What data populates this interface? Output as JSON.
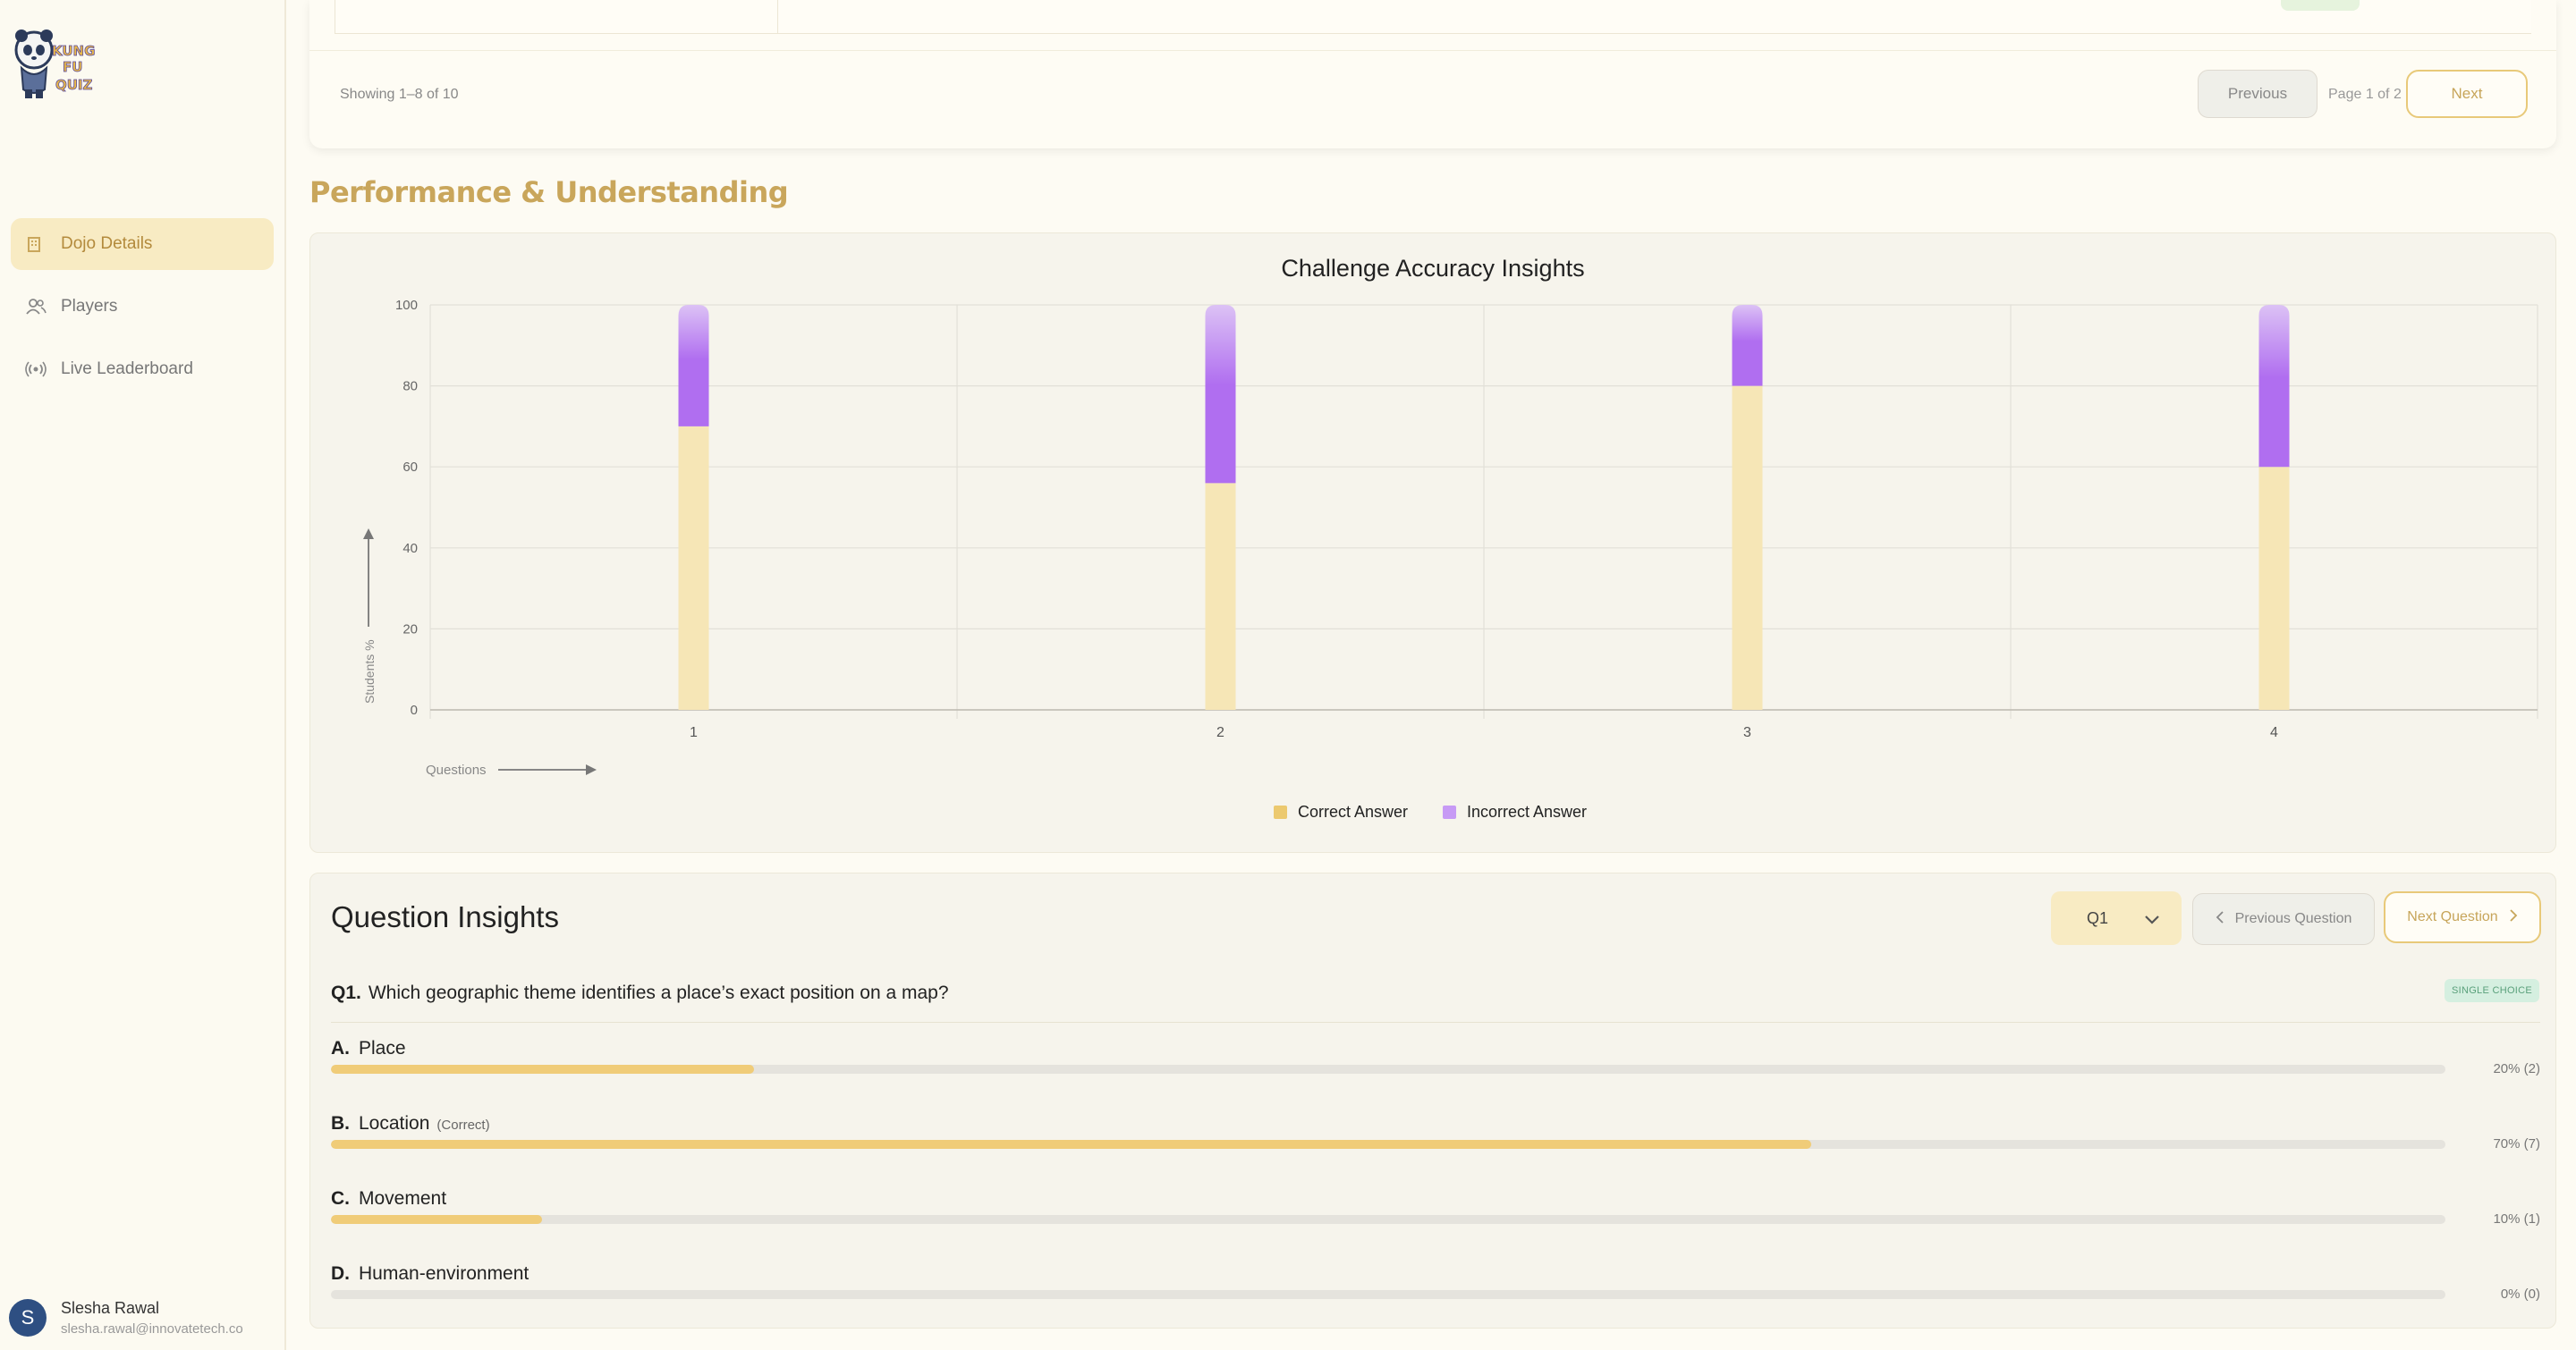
{
  "sidebar": {
    "nav": [
      {
        "label": "Dojo Details",
        "icon": "building-icon",
        "active": true
      },
      {
        "label": "Players",
        "icon": "users-icon",
        "active": false
      },
      {
        "label": "Live Leaderboard",
        "icon": "broadcast-icon",
        "active": false
      }
    ],
    "user": {
      "initial": "S",
      "name": "Slesha Rawal",
      "email": "slesha.rawal@innovatetech.co"
    }
  },
  "pagination": {
    "showing": "Showing 1–8 of 10",
    "previous": "Previous",
    "page_info": "Page 1 of 2",
    "next": "Next"
  },
  "section_title": "Performance & Understanding",
  "chart_data": {
    "type": "bar",
    "stacked": true,
    "title": "Challenge Accuracy Insights",
    "xlabel": "Questions",
    "ylabel": "Students %",
    "categories": [
      "1",
      "2",
      "3",
      "4"
    ],
    "series": [
      {
        "name": "Correct Answer",
        "values": [
          70,
          56,
          80,
          60
        ],
        "color": "#f6e6b6"
      },
      {
        "name": "Incorrect Answer",
        "values": [
          30,
          44,
          20,
          40
        ],
        "color": "#b06ef0"
      }
    ],
    "ylim": [
      0,
      100
    ],
    "yticks": [
      0,
      20,
      40,
      60,
      80,
      100
    ],
    "grid": true,
    "legend": "bottom-center"
  },
  "insights": {
    "title": "Question Insights",
    "selected_question": "Q1",
    "prev_button": "Previous Question",
    "next_button": "Next Question",
    "question_number": "Q1.",
    "question_text": "Which geographic theme identifies a place’s exact position on a map?",
    "question_type": "SINGLE CHOICE",
    "correct_tag": "(Correct)",
    "options": [
      {
        "letter": "A.",
        "text": "Place",
        "fraction": 0.2,
        "stat": "20% (2)",
        "correct": false
      },
      {
        "letter": "B.",
        "text": "Location",
        "fraction": 0.7,
        "stat": "70% (7)",
        "correct": true
      },
      {
        "letter": "C.",
        "text": "Movement",
        "fraction": 0.1,
        "stat": "10% (1)",
        "correct": false
      },
      {
        "letter": "D.",
        "text": "Human-environment",
        "fraction": 0.0,
        "stat": "0% (0)",
        "correct": false
      }
    ]
  }
}
